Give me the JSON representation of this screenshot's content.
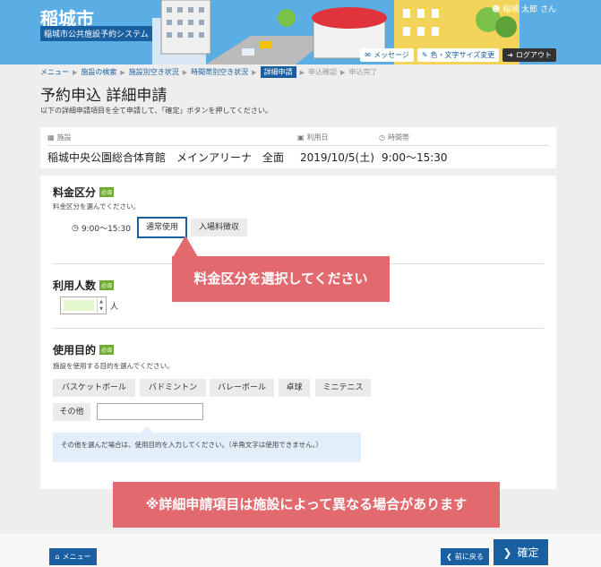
{
  "header": {
    "title": "稲城市",
    "subtitle": "稲城市公共施設予約システム",
    "user": "稲城 太郎 さん",
    "messages": "メッセージ",
    "text_size": "色・文字サイズ変更",
    "logout": "ログアウト"
  },
  "breadcrumb": [
    "メニュー",
    "施設の検索",
    "施設別空き状況",
    "時間帯別空き状況",
    "詳細申請",
    "申込確認",
    "申込完了"
  ],
  "page": {
    "title": "予約申込 詳細申請",
    "desc": "以下の詳細申請項目を全て申請して、「確定」ボタンを押してください。"
  },
  "summary": {
    "facility_label": "施設",
    "facility": "稲城中央公園総合体育館　メインアリーナ　全面",
    "date_label": "利用日",
    "date": "2019/10/5(土)",
    "time_label": "時間帯",
    "time": "9:00〜15:30"
  },
  "fee": {
    "title": "料金区分",
    "required": "必須",
    "desc": "料金区分を選んでください。",
    "time": "9:00〜15:30",
    "options": [
      "通常使用",
      "入場料徴収"
    ],
    "selected": "通常使用"
  },
  "people": {
    "title": "利用人数",
    "required": "必須",
    "value": "",
    "unit": "人"
  },
  "purpose": {
    "title": "使用目的",
    "required": "必須",
    "desc": "施設を使用する目的を選んでください。",
    "options": [
      "バスケットボール",
      "バドミントン",
      "バレーボール",
      "卓球",
      "ミニテニス",
      "その他"
    ],
    "other_value": "",
    "note": "その他を選んだ場合は、使用目的を入力してください。（半角文字は使用できません。）"
  },
  "callouts": {
    "fee": "料金区分を選択してください",
    "note": "※詳細申請項目は施設によって異なる場合があります"
  },
  "footer": {
    "menu": "メニュー",
    "back": "前に戻る",
    "confirm": "確定"
  },
  "colors": {
    "accent": "#1a5fa0",
    "header_bg": "#5aaee3",
    "callout": "#e26a6f",
    "required": "#6cad2b"
  }
}
